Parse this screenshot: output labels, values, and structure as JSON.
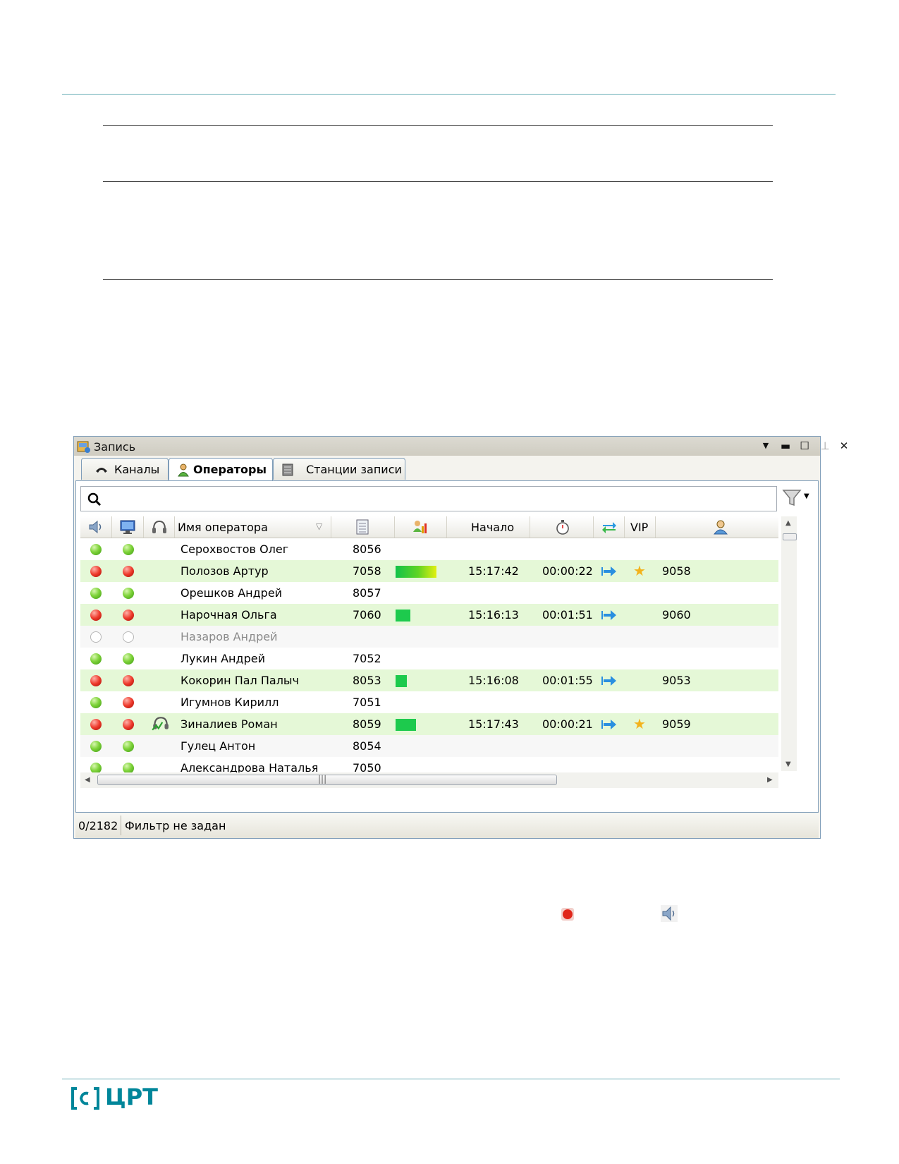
{
  "window": {
    "title": "Запись",
    "tabs": [
      {
        "label": "Каналы",
        "icon": "phone-handset-icon"
      },
      {
        "label": "Операторы",
        "icon": "operator-icon",
        "active": true
      },
      {
        "label": "Станции записи",
        "icon": "station-icon"
      }
    ],
    "search": {
      "value": "",
      "placeholder": ""
    },
    "columns": {
      "sound": "speaker-icon",
      "screen": "monitor-icon",
      "headset": "headphones-icon",
      "name": "Имя оператора",
      "phone": "phone-list-icon",
      "level": "level-icon",
      "start": "Начало",
      "duration": "stopwatch-icon",
      "direction": "transfer-icon",
      "vip": "VIP",
      "subscriber": "person-icon"
    },
    "rows": [
      {
        "sound": "green",
        "screen": "green",
        "headset": "",
        "name": "Серохвостов Олег",
        "phone": "8056",
        "level": "",
        "start": "",
        "duration": "",
        "direction": "",
        "vip": "",
        "subscriber": "",
        "style": "normal"
      },
      {
        "sound": "red",
        "screen": "red",
        "headset": "",
        "name": "Полозов Артур",
        "phone": "7058",
        "level": "full",
        "start": "15:17:42",
        "duration": "00:00:22",
        "direction": "out",
        "vip": "star",
        "subscriber": "9058",
        "style": "hl"
      },
      {
        "sound": "green",
        "screen": "green",
        "headset": "",
        "name": "Орешков Андрей",
        "phone": "8057",
        "level": "",
        "start": "",
        "duration": "",
        "direction": "",
        "vip": "",
        "subscriber": "",
        "style": "normal"
      },
      {
        "sound": "red",
        "screen": "red",
        "headset": "",
        "name": "Нарочная Ольга",
        "phone": "7060",
        "level": "short",
        "start": "15:16:13",
        "duration": "00:01:51",
        "direction": "out",
        "vip": "",
        "subscriber": "9060",
        "style": "hl"
      },
      {
        "sound": "empty",
        "screen": "empty",
        "headset": "",
        "name": "Назаров Андрей",
        "phone": "",
        "level": "",
        "start": "",
        "duration": "",
        "direction": "",
        "vip": "",
        "subscriber": "",
        "style": "alt"
      },
      {
        "sound": "green",
        "screen": "green",
        "headset": "",
        "name": "Лукин Андрей",
        "phone": "7052",
        "level": "",
        "start": "",
        "duration": "",
        "direction": "",
        "vip": "",
        "subscriber": "",
        "style": "normal"
      },
      {
        "sound": "red",
        "screen": "red",
        "headset": "",
        "name": "Кокорин Пал Палыч",
        "phone": "8053",
        "level": "tiny",
        "start": "15:16:08",
        "duration": "00:01:55",
        "direction": "out",
        "vip": "",
        "subscriber": "9053",
        "style": "hl"
      },
      {
        "sound": "green",
        "screen": "red",
        "headset": "",
        "name": "Игумнов Кирилл",
        "phone": "7051",
        "level": "",
        "start": "",
        "duration": "",
        "direction": "",
        "vip": "",
        "subscriber": "",
        "style": "normal"
      },
      {
        "sound": "red",
        "screen": "red",
        "headset": "listen",
        "name": "Зиналиев Роман",
        "phone": "8059",
        "level": "medium",
        "start": "15:17:43",
        "duration": "00:00:21",
        "direction": "out",
        "vip": "star",
        "subscriber": "9059",
        "style": "hl"
      },
      {
        "sound": "green",
        "screen": "green",
        "headset": "",
        "name": "Гулец Антон",
        "phone": "8054",
        "level": "",
        "start": "",
        "duration": "",
        "direction": "",
        "vip": "",
        "subscriber": "",
        "style": "alt"
      },
      {
        "sound": "green",
        "screen": "green",
        "headset": "",
        "name": "Александрова Наталья",
        "phone": "7050",
        "level": "",
        "start": "",
        "duration": "",
        "direction": "",
        "vip": "",
        "subscriber": "",
        "style": "normal"
      }
    ],
    "status": {
      "count": "0/2182",
      "message": "Фильтр не задан"
    }
  },
  "legend": {
    "icons": [
      "red-dot-icon",
      "speaker-icon"
    ]
  },
  "logo": {
    "text": "ЦРТ"
  },
  "colors": {
    "accent": "#00869a",
    "row_highlight": "#e5f8d7",
    "green": "#4cba1a",
    "red": "#e0261a"
  }
}
